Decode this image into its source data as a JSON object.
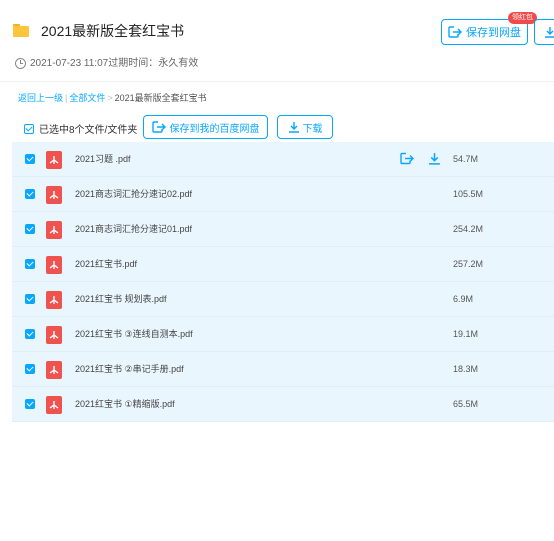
{
  "header": {
    "title": "2021最新版全套红宝书",
    "meta": "2021-07-23 11:07过期时间：永久有效",
    "save_button": "保存到网盘",
    "badge": "领红包"
  },
  "breadcrumb": {
    "back": "返回上一级",
    "all_files": "全部文件",
    "separator": ">",
    "current": "2021最新版全套红宝书"
  },
  "toolbar": {
    "selected_text": "已选中8个文件/文件夹",
    "save_baidu": "保存到我的百度网盘",
    "download": "下载"
  },
  "files": [
    {
      "name": "2021习题 .pdf",
      "size": "54.7M"
    },
    {
      "name": "2021商志词汇抢分速记02.pdf",
      "size": "105.5M"
    },
    {
      "name": "2021商志词汇抢分速记01.pdf",
      "size": "254.2M"
    },
    {
      "name": "2021红宝书.pdf",
      "size": "257.2M"
    },
    {
      "name": "2021红宝书 规划表.pdf",
      "size": "6.9M"
    },
    {
      "name": "2021红宝书 ③连线自测本.pdf",
      "size": "19.1M"
    },
    {
      "name": "2021红宝书 ②串记手册.pdf",
      "size": "18.3M"
    },
    {
      "name": "2021红宝书 ①精缩版.pdf",
      "size": "65.5M"
    }
  ],
  "colors": {
    "accent": "#06a7ff",
    "row_bg": "#eaf6fe",
    "pdf_red": "#ef5350",
    "badge_red": "#f04a4a",
    "folder_yellow": "#fcc53d"
  },
  "icons": [
    "folder-icon",
    "clock-icon",
    "save-icon",
    "download-icon",
    "checkbox-icon",
    "pdf-icon"
  ]
}
